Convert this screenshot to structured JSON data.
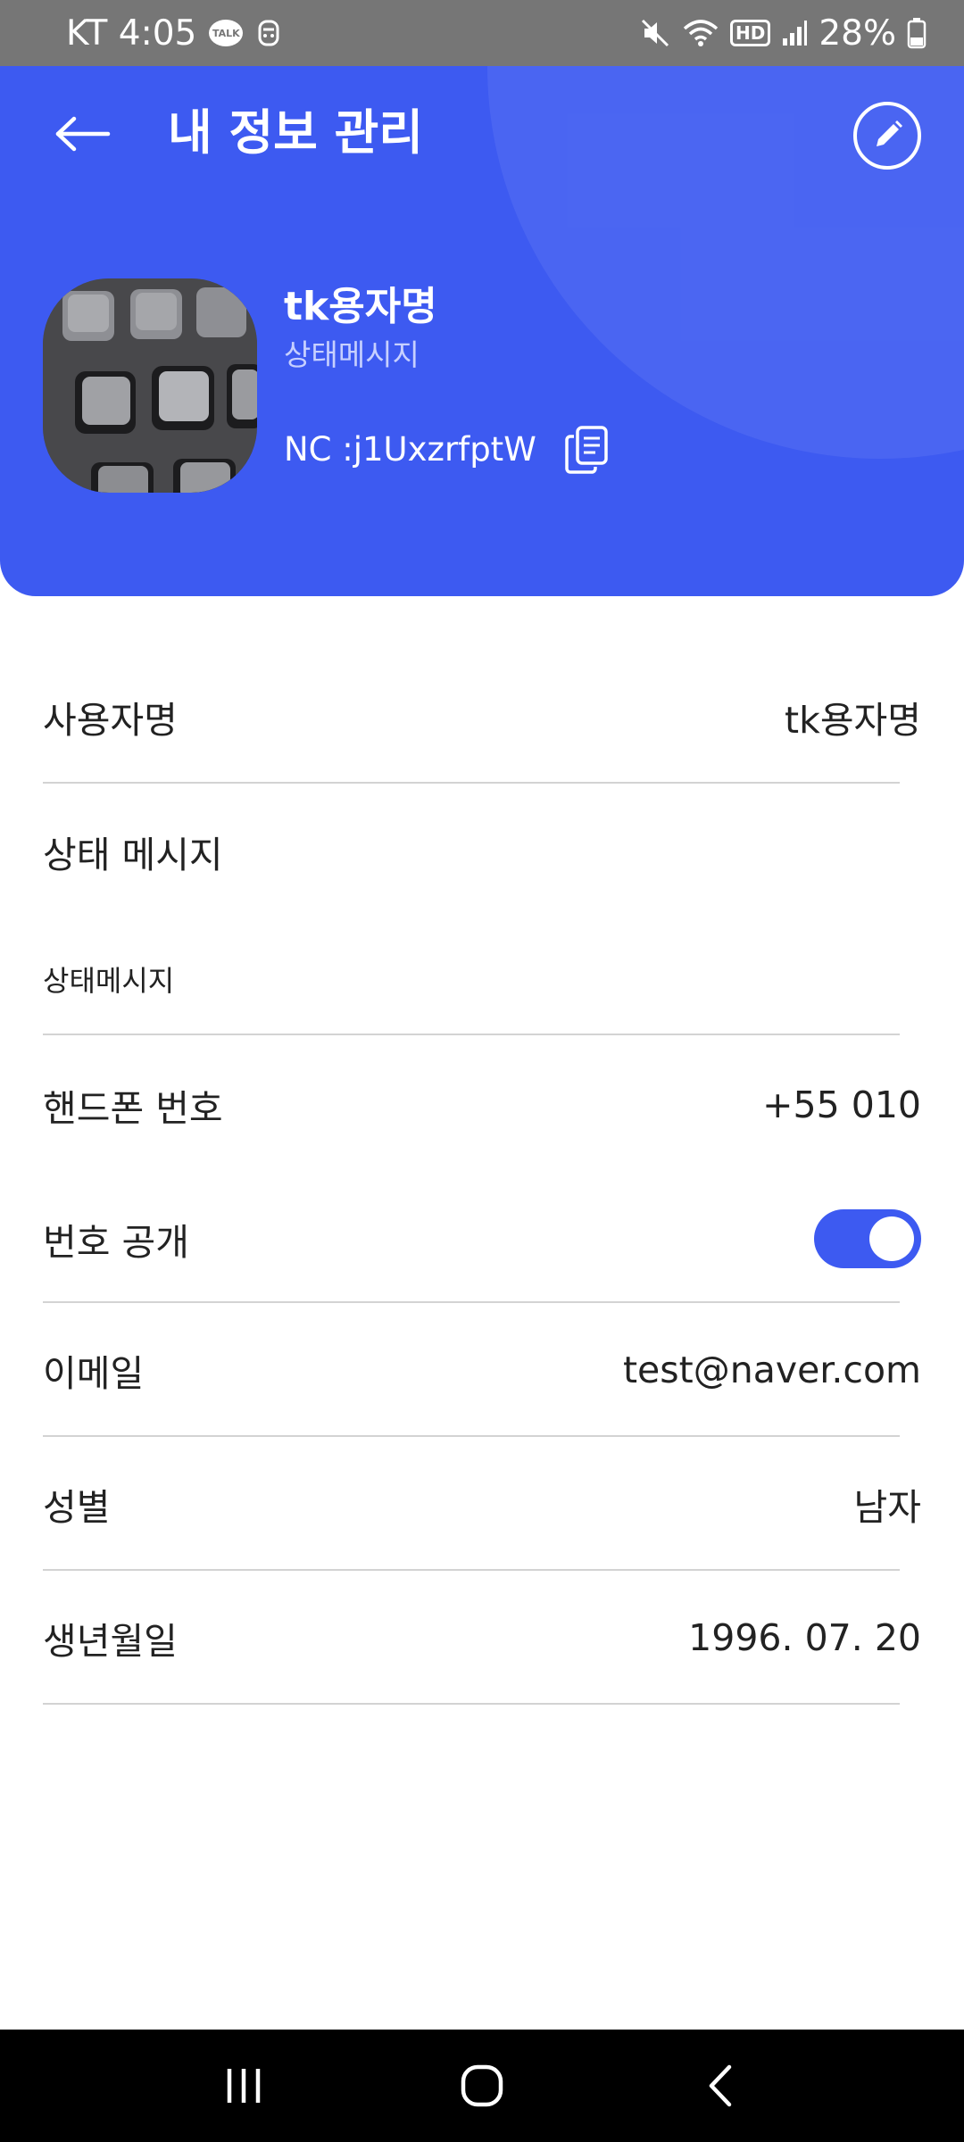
{
  "status_bar": {
    "carrier_time": "KT 4:05",
    "talk_badge": "TALK",
    "network_badge": "HD",
    "battery": "28%",
    "icons": [
      "kakaotalk-icon",
      "notification-icon",
      "mute-icon",
      "wifi-icon",
      "hd-icon",
      "signal-icon",
      "battery-icon"
    ]
  },
  "header": {
    "title": "내 정보 관리",
    "back_icon": "arrow-left-icon",
    "edit_icon": "pencil-icon",
    "accent_color": "#3d5af1"
  },
  "profile": {
    "name": "tk용자명",
    "status_message": "상태메시지",
    "nc_code": "NC :j1UxzrfptW",
    "copy_icon": "copy-icon"
  },
  "info": {
    "username": {
      "label": "사용자명",
      "value": "tk용자명"
    },
    "status": {
      "label": "상태 메시지",
      "value": "상태메시지"
    },
    "phone": {
      "label": "핸드폰 번호",
      "value": "+55 010"
    },
    "phone_public": {
      "label": "번호 공개",
      "enabled": true
    },
    "email": {
      "label": "이메일",
      "value": "test@naver.com"
    },
    "gender": {
      "label": "성별",
      "value": "남자"
    },
    "birthday": {
      "label": "생년월일",
      "value": "1996. 07. 20"
    }
  },
  "nav_bar": {
    "icons": [
      "recent-apps-icon",
      "home-icon",
      "back-icon"
    ]
  }
}
